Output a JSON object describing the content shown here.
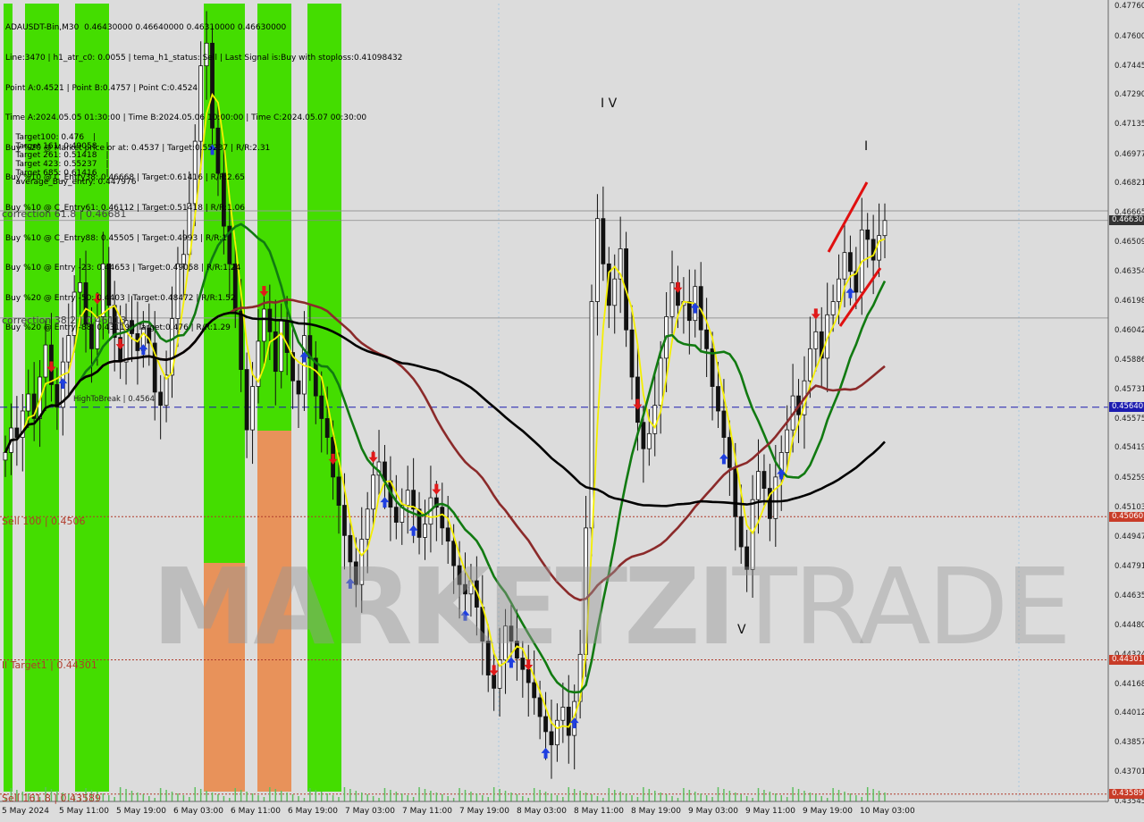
{
  "header_lines": [
    "ADAUSDT-Bin,M30  0.46430000 0.46640000 0.46310000 0.46630000",
    "Line:3470 | h1_atr_c0: 0.0055 | tema_h1_status: Sell | Last Signal is:Buy with stoploss:0.41098432",
    "Point A:0.4521 | Point B:0.4757 | Point C:0.4524",
    "Time A:2024.05.05 01:30:00 | Time B:2024.05.06 10:00:00 | Time C:2024.05.07 00:30:00",
    "Buy %20 @ Market price or at: 0.4537 | Target:0.55237 | R/R:2.31",
    "Buy %10 @ C_Entry38: 0.46668 | Target:0.61416 | R/R:2.65",
    "Buy %10 @ C_Entry61: 0.46112 | Target:0.51418 | R/R:1.06",
    "Buy %10 @ C_Entry88: 0.45505 | Target:0.4993 | R/R:1",
    "Buy %10 @ Entry -23: 0.44653 | Target:0.49058 | R/R:1.24",
    "Buy %20 @ Entry -50: 0.4403 | Target:0.48472 | R/R:1.52",
    "Buy %20 @ Entry -88: 0.43119 | Target:0.476 | R/R:1.29"
  ],
  "targets_line": [
    "Target100: 0.476",
    "Target 161: 0.49058",
    "Target 261: 0.51418",
    "Target 423: 0.55237",
    "Target 685: 0.61416",
    "average_Buy_entry: 0.447976"
  ],
  "level_labels": {
    "corr618": "correction 61.8 | 0.46681",
    "corr382": "correction 38.2 | 0.46113",
    "high_to_break": "HighToBreak | 0.4564",
    "sell100": "Sell 100 | 0.4506",
    "target1": "ll Target1 | 0.44301",
    "sell161": "Sell 161.8 | 0.43589"
  },
  "wave_labels": {
    "iv": "I V",
    "i": "I",
    "v": "V"
  },
  "watermark": {
    "part1": "MARKETZI",
    "part2": "TRADE"
  },
  "colors": {
    "background": "#dcdcdc",
    "green_zone": "#44dd00",
    "orange_zone": "#e8925a",
    "bull_candle": "#111111",
    "ma_yellow": "#f5f000",
    "ma_green": "#117a11",
    "ma_brown": "#8b2a2a",
    "ma_black": "#000000",
    "level_blue": "#1c1cb0",
    "level_red": "#b03a2a",
    "badge_red": "#c83c28",
    "badge_gray": "#333333",
    "arrow_up": "#1f3fe0",
    "arrow_down": "#e01a1a"
  },
  "chart_data": {
    "type": "candlestick",
    "symbol": "ADAUSDT-Bin",
    "timeframe": "M30",
    "ylim": [
      0.4355,
      0.4778
    ],
    "y_ticks": [
      "0.47760",
      "0.47600",
      "0.47445",
      "0.47290",
      "0.47135",
      "0.46977",
      "0.46821",
      "0.46665",
      "0.46509",
      "0.46354",
      "0.46198",
      "0.46042",
      "0.45886",
      "0.45731",
      "0.45575",
      "0.45419",
      "0.45259",
      "0.45103",
      "0.44947",
      "0.44791",
      "0.44635",
      "0.44480",
      "0.44324",
      "0.44168",
      "0.44012",
      "0.43857",
      "0.43701",
      "0.43545"
    ],
    "x_labels": [
      "5 May 2024",
      "5 May 11:00",
      "5 May 19:00",
      "6 May 03:00",
      "6 May 11:00",
      "6 May 19:00",
      "7 May 03:00",
      "7 May 11:00",
      "7 May 19:00",
      "8 May 03:00",
      "8 May 11:00",
      "8 May 19:00",
      "9 May 03:00",
      "9 May 11:00",
      "9 May 19:00",
      "10 May 03:00"
    ],
    "price_badges": [
      {
        "label": "0.46630",
        "value": 0.4663,
        "color": "#333333"
      },
      {
        "label": "0.45640",
        "value": 0.4564,
        "color": "#1c1cb0"
      },
      {
        "label": "0.45060",
        "value": 0.4506,
        "color": "#c83c28"
      },
      {
        "label": "0.44301",
        "value": 0.44301,
        "color": "#c83c28"
      },
      {
        "label": "0.43589",
        "value": 0.43589,
        "color": "#c83c28"
      }
    ],
    "levels": [
      {
        "name": "correction 61.8",
        "value": 0.46681
      },
      {
        "name": "current price",
        "value": 0.4663
      },
      {
        "name": "correction 38.2",
        "value": 0.46113
      },
      {
        "name": "HighToBreak",
        "value": 0.4564
      },
      {
        "name": "Sell 100",
        "value": 0.4506
      },
      {
        "name": "Target1",
        "value": 0.44301
      },
      {
        "name": "Sell 161.8",
        "value": 0.43589
      }
    ],
    "closes": [
      0.454,
      0.4553,
      0.4548,
      0.4562,
      0.4571,
      0.4558,
      0.458,
      0.4597,
      0.4576,
      0.4564,
      0.4588,
      0.4602,
      0.4625,
      0.463,
      0.4608,
      0.4595,
      0.4612,
      0.464,
      0.4618,
      0.4601,
      0.4588,
      0.461,
      0.4603,
      0.4594,
      0.4606,
      0.4598,
      0.4572,
      0.4565,
      0.4581,
      0.4611,
      0.464,
      0.4645,
      0.4672,
      0.4705,
      0.4745,
      0.4757,
      0.4712,
      0.4688,
      0.466,
      0.464,
      0.4615,
      0.4584,
      0.4552,
      0.4575,
      0.4599,
      0.4616,
      0.4604,
      0.4583,
      0.461,
      0.4593,
      0.4578,
      0.4571,
      0.4602,
      0.459,
      0.457,
      0.4558,
      0.4548,
      0.4527,
      0.4512,
      0.4496,
      0.4482,
      0.447,
      0.4494,
      0.451,
      0.4528,
      0.4535,
      0.4525,
      0.4511,
      0.4503,
      0.4512,
      0.452,
      0.451,
      0.4495,
      0.4502,
      0.4516,
      0.4511,
      0.45,
      0.4493,
      0.448,
      0.447,
      0.4465,
      0.4472,
      0.4458,
      0.444,
      0.4422,
      0.4415,
      0.443,
      0.4448,
      0.444,
      0.4431,
      0.4425,
      0.4418,
      0.441,
      0.44,
      0.4392,
      0.4385,
      0.4398,
      0.4405,
      0.439,
      0.4408,
      0.4433,
      0.45,
      0.462,
      0.4664,
      0.464,
      0.4618,
      0.4632,
      0.4648,
      0.4605,
      0.458,
      0.4556,
      0.4542,
      0.455,
      0.4565,
      0.459,
      0.4612,
      0.463,
      0.4618,
      0.462,
      0.461,
      0.4628,
      0.4605,
      0.4595,
      0.4575,
      0.4562,
      0.4548,
      0.4532,
      0.4506,
      0.449,
      0.4478,
      0.4515,
      0.453,
      0.4521,
      0.4505,
      0.4527,
      0.454,
      0.4552,
      0.457,
      0.456,
      0.4578,
      0.4595,
      0.4604,
      0.459,
      0.4613,
      0.462,
      0.4632,
      0.4646,
      0.4636,
      0.4625,
      0.4658,
      0.4653,
      0.4642,
      0.4655,
      0.4663
    ]
  }
}
